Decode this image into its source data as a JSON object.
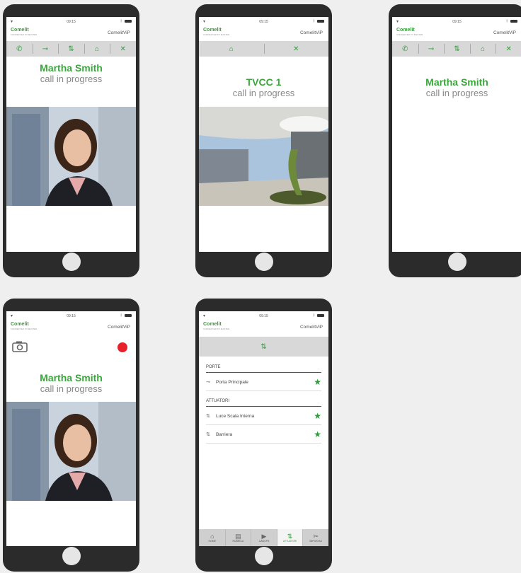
{
  "status": {
    "time": "09:15"
  },
  "brand": {
    "name": "Comelit",
    "tagline": "CONNECTED TO MASTER"
  },
  "app_name": "ComelitViP",
  "phones": [
    {
      "name": "Martha Smith",
      "status": "call in progress"
    },
    {
      "name": "TVCC 1",
      "status": "call in progress"
    },
    {
      "name": "Martha Smith",
      "status": "call in progress"
    },
    {
      "name": "Martha Smith",
      "status": "call in progress"
    }
  ],
  "list": {
    "section_porte": "PORTE",
    "porte_items": [
      {
        "label": "Porta Principale"
      }
    ],
    "section_attuatori": "ATTUATORI",
    "attuatori_items": [
      {
        "label": "Luce Scala Interna"
      },
      {
        "label": "Barriera"
      }
    ]
  },
  "tabs": [
    {
      "label": "HOME",
      "icon": "home-icon"
    },
    {
      "label": "RUBRICA",
      "icon": "addressbook-icon"
    },
    {
      "label": "CANCPS",
      "icon": "camera-icon"
    },
    {
      "label": "ATTUATORI",
      "icon": "actuator-icon"
    },
    {
      "label": "IMPOSTAZ",
      "icon": "settings-icon"
    }
  ],
  "colors": {
    "accent": "#3aa63c",
    "record": "#e8202a",
    "toolbar": "#d8d8d8",
    "phone": "#2b2b2b"
  }
}
